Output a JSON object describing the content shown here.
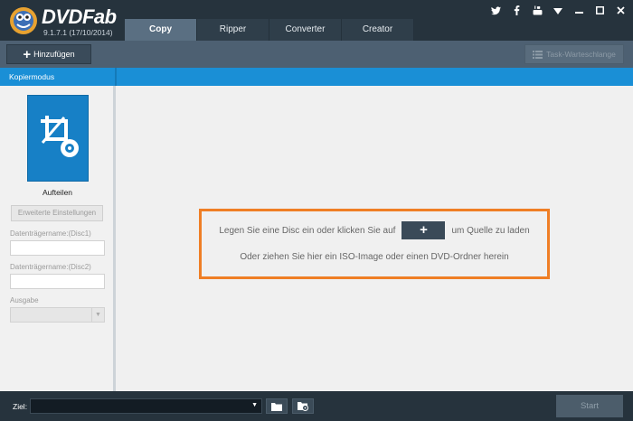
{
  "app": {
    "logo_text": "DVDFab",
    "version": "9.1.7.1 (17/10/2014)"
  },
  "tabs": [
    {
      "label": "Copy",
      "active": true
    },
    {
      "label": "Ripper",
      "active": false
    },
    {
      "label": "Converter",
      "active": false
    },
    {
      "label": "Creator",
      "active": false
    }
  ],
  "window_controls": [
    "twitter-icon",
    "facebook-icon",
    "youtube-icon",
    "dropdown-icon",
    "minimize-icon",
    "maximize-icon",
    "close-icon"
  ],
  "toolbar": {
    "add_label": "Hinzufügen",
    "queue_label": "Task-Warteschlange"
  },
  "modebar": {
    "label": "Kopiermodus"
  },
  "sidebar": {
    "mode_label": "Aufteilen",
    "advanced_label": "Erweiterte Einstellungen",
    "disc1_label": "Datenträgername:(Disc1)",
    "disc1_value": "",
    "disc2_label": "Datenträgername:(Disc2)",
    "disc2_value": "",
    "output_label": "Ausgabe",
    "output_value": ""
  },
  "main": {
    "line1_before": "Legen Sie eine Disc ein oder klicken Sie auf",
    "add_source_symbol": "+",
    "line1_after": "um Quelle zu laden",
    "line2": "Oder ziehen Sie hier ein ISO-Image oder einen DVD-Ordner herein"
  },
  "bottombar": {
    "target_label": "Ziel:",
    "target_value": "",
    "start_label": "Start"
  },
  "colors": {
    "accent_blue": "#1a8fd6",
    "highlight_orange": "#ef7e25",
    "titlebar": "#26333d"
  }
}
